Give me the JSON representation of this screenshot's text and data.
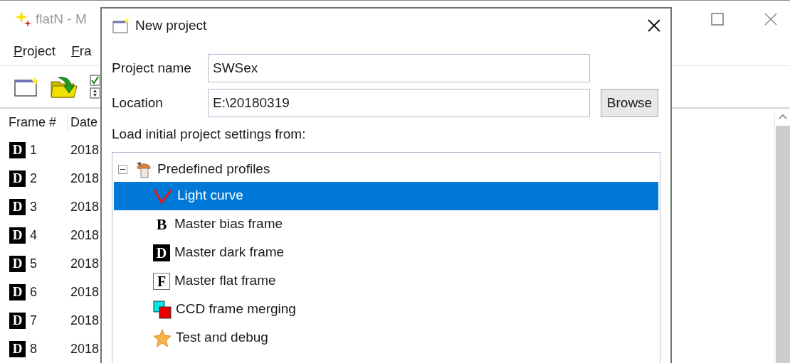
{
  "main_window": {
    "title": "flatN - M",
    "menu": [
      "Project",
      "Fra"
    ],
    "table": {
      "columns": [
        "Frame #",
        "Date"
      ],
      "rows": [
        {
          "badge": "D",
          "frame": "1",
          "date": "2018"
        },
        {
          "badge": "D",
          "frame": "2",
          "date": "2018"
        },
        {
          "badge": "D",
          "frame": "3",
          "date": "2018"
        },
        {
          "badge": "D",
          "frame": "4",
          "date": "2018"
        },
        {
          "badge": "D",
          "frame": "5",
          "date": "2018"
        },
        {
          "badge": "D",
          "frame": "6",
          "date": "2018"
        },
        {
          "badge": "D",
          "frame": "7",
          "date": "2018"
        },
        {
          "badge": "D",
          "frame": "8",
          "date": "2018"
        }
      ]
    }
  },
  "dialog": {
    "title": "New project",
    "fields": [
      {
        "label": "Project name",
        "value": "SWSex"
      },
      {
        "label": "Location",
        "value": "E:\\20180319",
        "button": "Browse"
      }
    ],
    "section_label": "Load initial project settings from:",
    "tree": {
      "label": "Predefined profiles",
      "expanded": true,
      "children": [
        {
          "label": "Light curve",
          "kind": "curve",
          "selected": true
        },
        {
          "label": "Master bias frame",
          "kind": "letter-plain",
          "glyph": "B",
          "selected": false
        },
        {
          "label": "Master dark frame",
          "kind": "letter-dark",
          "glyph": "D",
          "selected": false
        },
        {
          "label": "Master flat frame",
          "kind": "letter-framed",
          "glyph": "F",
          "selected": false
        },
        {
          "label": "CCD frame merging",
          "kind": "merge",
          "selected": false
        },
        {
          "label": "Test and debug",
          "kind": "star",
          "selected": false
        }
      ]
    }
  }
}
